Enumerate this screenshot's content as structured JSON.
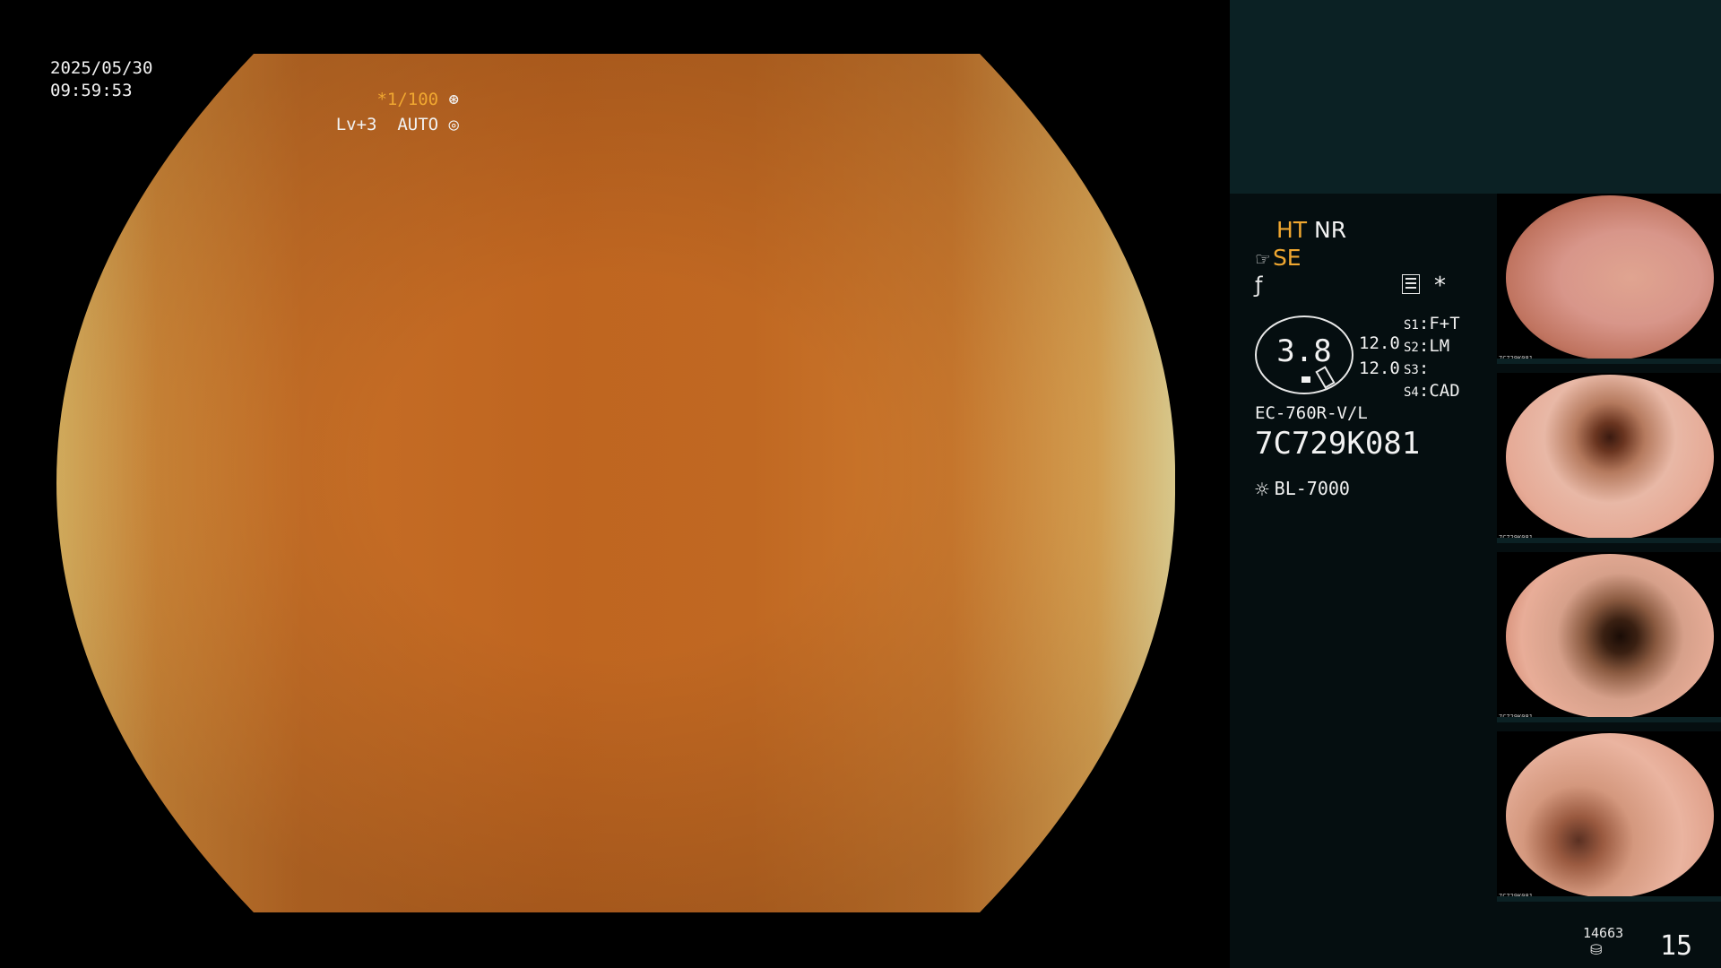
{
  "overlay": {
    "date": "2025/05/30",
    "time": "09:59:53",
    "shutter": "*1/100",
    "shutter_icon": "aperture-icon",
    "level": "Lv+3  AUTO",
    "level_icon": "iris-icon"
  },
  "side": {
    "ht": "HT",
    "nr": "NR",
    "se": "SE",
    "gauge_value": "3.8",
    "value_a": "12.0",
    "value_b": "12.0",
    "switches": [
      {
        "key": "S1",
        "value": "F+T"
      },
      {
        "key": "S2",
        "value": "LM"
      },
      {
        "key": "S3",
        "value": ""
      },
      {
        "key": "S4",
        "value": "CAD"
      }
    ],
    "scope_model": "EC-760R-V/L",
    "scope_serial": "7C729K081",
    "light_source": "BL-7000",
    "counter_small": "14663",
    "counter_big": "15"
  },
  "thumbnails": [
    {
      "caption": "7C729K081"
    },
    {
      "caption": "7C729K081"
    },
    {
      "caption": "7C729K081"
    },
    {
      "caption": "7C729K081"
    }
  ],
  "colors": {
    "amber": "#f0a730",
    "panel_top": "#0b2124",
    "panel": "#050e10"
  }
}
